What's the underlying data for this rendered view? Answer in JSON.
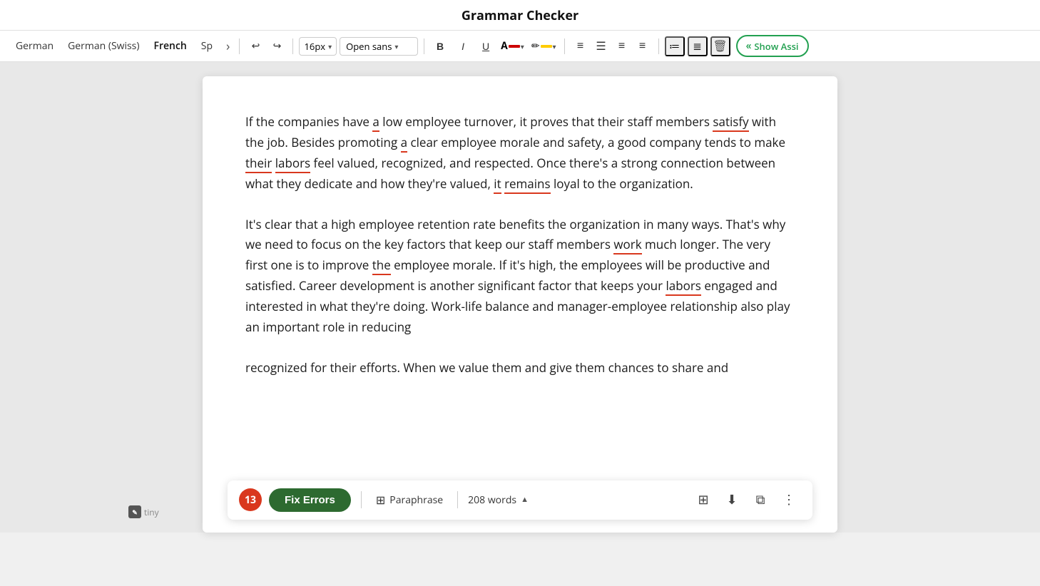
{
  "app": {
    "title": "Grammar Checker"
  },
  "toolbar": {
    "languages": [
      "German",
      "German (Swiss)",
      "French",
      "Sp"
    ],
    "active_lang": "French",
    "font_size": "16px",
    "font_family": "Open sans",
    "nav": {
      "back_label": "←",
      "forward_label": "→",
      "more_label": "›"
    },
    "format": {
      "bold": "B",
      "italic": "I",
      "underline": "U"
    },
    "align": {
      "left": "≡",
      "center": "≡",
      "right": "≡",
      "justify": "≡"
    },
    "show_assist_label": "Show Assi"
  },
  "content": {
    "paragraph1": "If the companies have a low employee turnover, it proves that their staff members satisfy with the job. Besides promoting a clear employee morale and safety, a good company tends to make their labors feel valued, recognized, and respected. Once there's a strong connection between what they dedicate and how they're valued, it remains loyal to the organization.",
    "paragraph2": "It's clear that a high employee retention rate benefits the organization in many ways. That's why we need to focus on the key factors that keep our staff members work much longer. The very first one is to improve the employee morale. If it's high, the employees will be productive and satisfied. Career development is another significant factor that keeps your labors engaged and interested in what they're doing. Work-life balance and manager-employee relationship also play an important role in reducing",
    "paragraph3": "recognized for their efforts. When we value them and give them chances to share and"
  },
  "bottom_bar": {
    "error_count": "13",
    "fix_errors_label": "Fix Errors",
    "paraphrase_label": "Paraphrase",
    "word_count": "208 words",
    "more_label": "⋮"
  },
  "tiny_logo": "tiny"
}
